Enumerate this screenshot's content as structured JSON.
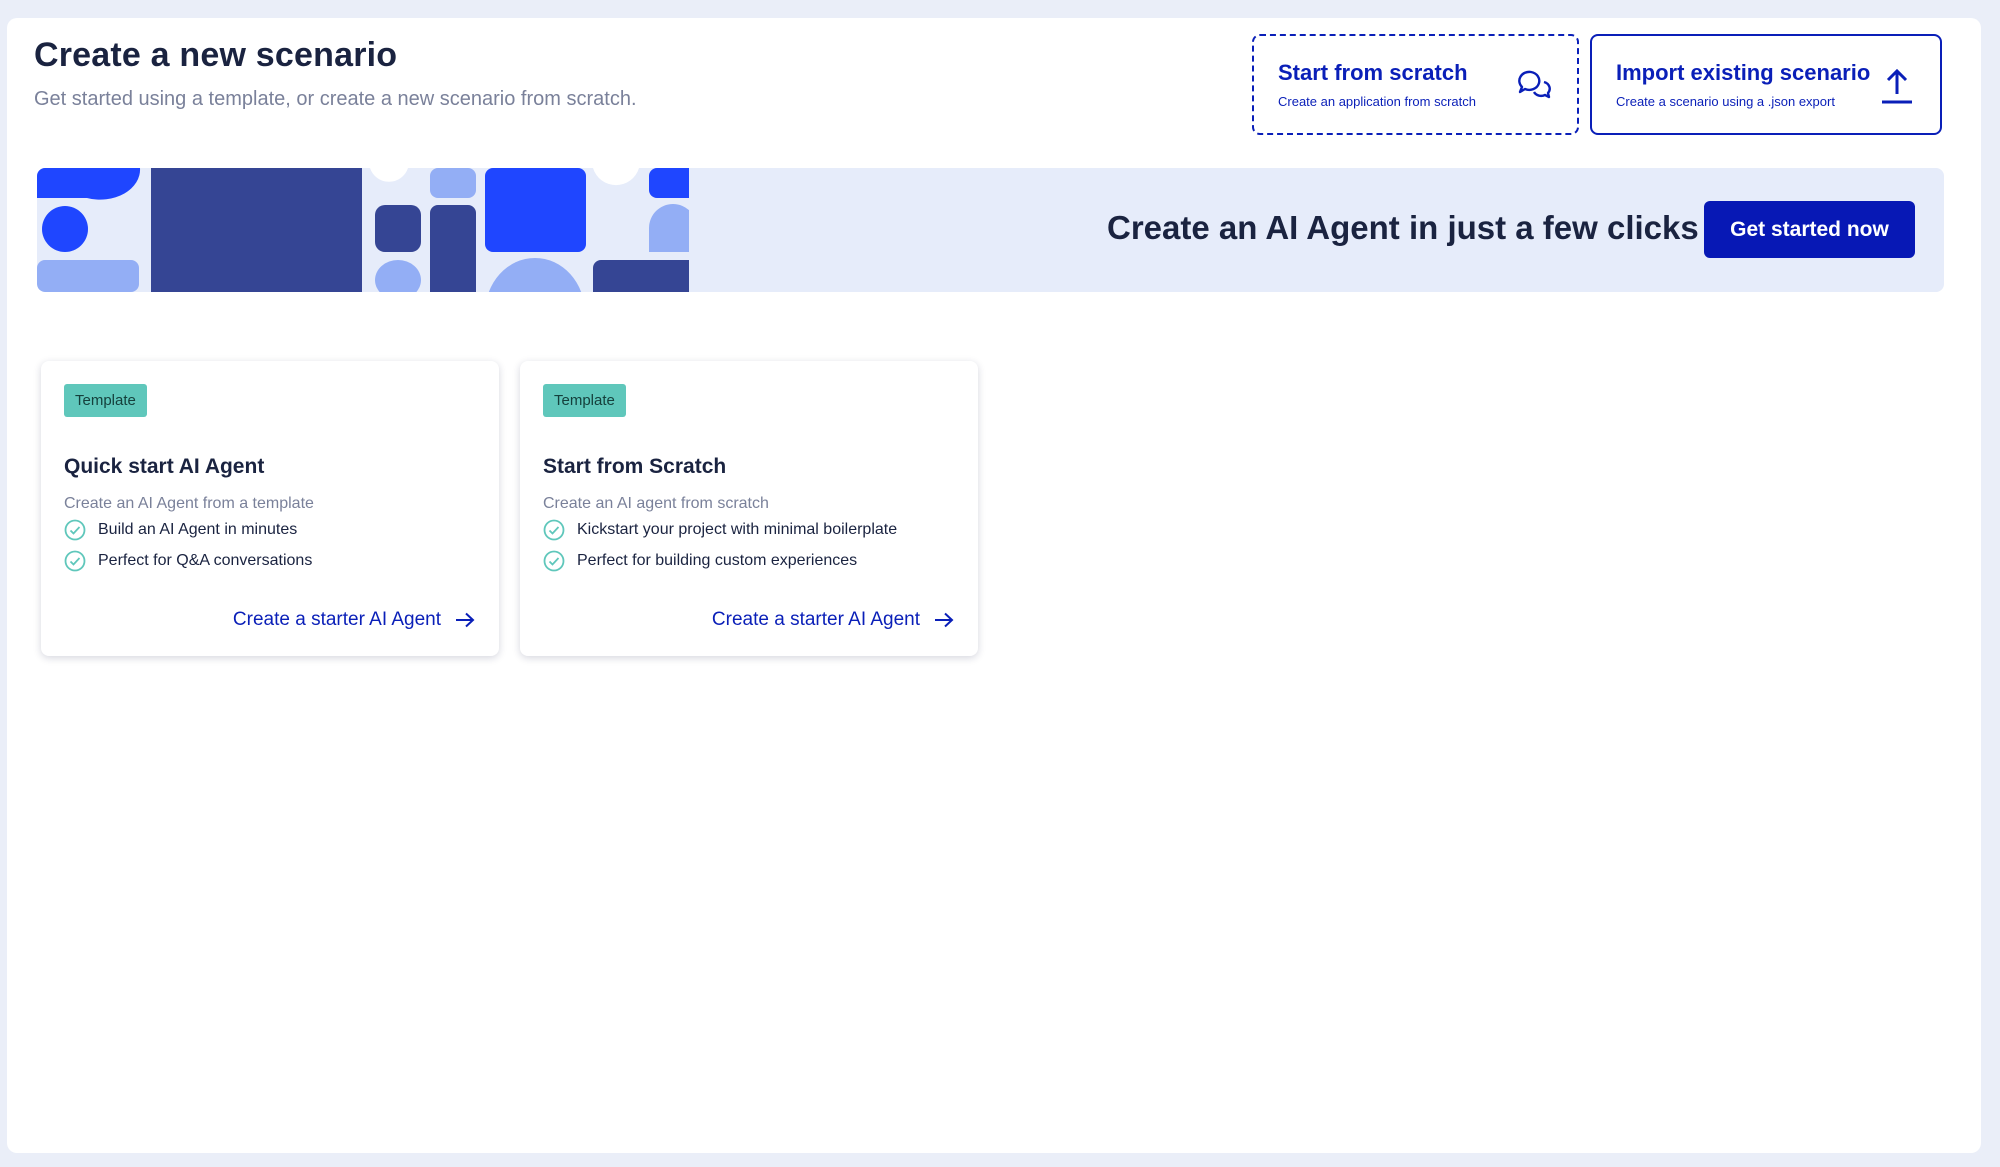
{
  "page": {
    "title": "Create a new scenario",
    "subtitle": "Get started using a template, or create a new scenario from scratch."
  },
  "header_actions": [
    {
      "title": "Start from scratch",
      "subtitle": "Create an application from scratch",
      "icon": "chat-bubbles-icon"
    },
    {
      "title": "Import existing scenario",
      "subtitle": "Create a scenario using a .json export",
      "icon": "upload-icon"
    }
  ],
  "banner": {
    "text": "Create an AI Agent in just a few clicks",
    "button_label": "Get started now"
  },
  "cards": [
    {
      "badge": "Template",
      "title": "Quick start AI Agent",
      "description": "Create an AI Agent from a template",
      "features": [
        "Build an AI Agent in minutes",
        "Perfect for Q&A conversations"
      ],
      "link": "Create a starter AI Agent"
    },
    {
      "badge": "Template",
      "title": "Start from Scratch",
      "description": "Create an AI agent from scratch",
      "features": [
        "Kickstart your project with minimal boilerplate",
        "Perfect for building custom experiences"
      ],
      "link": "Create a starter AI Agent"
    }
  ],
  "colors": {
    "brand_blue": "#0a1fb8",
    "cta_blue": "#0718b5",
    "badge_teal": "#5fc7bb",
    "banner_bg": "#e6ecfa",
    "shape_dark": "#354594",
    "shape_bright": "#1f46ff",
    "shape_light": "#93aef5"
  }
}
